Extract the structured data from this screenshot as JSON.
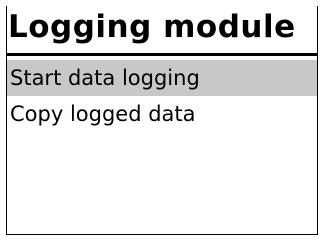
{
  "title": "Logging module",
  "menu": {
    "items": [
      {
        "label": "Start data logging",
        "selected": true
      },
      {
        "label": "Copy logged data",
        "selected": false
      }
    ]
  },
  "colors": {
    "selection": "#c8c8c8",
    "text": "#000000",
    "background": "#ffffff"
  }
}
